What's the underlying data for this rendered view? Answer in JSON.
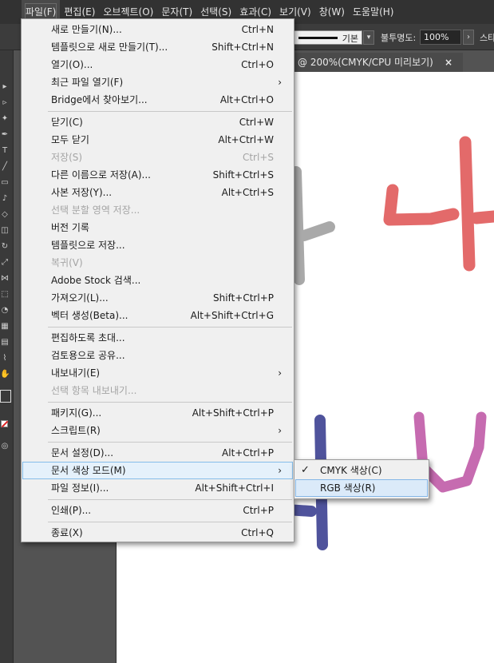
{
  "menubar": {
    "items": [
      {
        "label": "파일(F)"
      },
      {
        "label": "편집(E)"
      },
      {
        "label": "오브젝트(O)"
      },
      {
        "label": "문자(T)"
      },
      {
        "label": "선택(S)"
      },
      {
        "label": "효과(C)"
      },
      {
        "label": "보기(V)"
      },
      {
        "label": "창(W)"
      },
      {
        "label": "도움말(H)"
      }
    ]
  },
  "controlbar": {
    "stroke_label": "기본",
    "opacity_label": "불투명도:",
    "opacity_value": "100%",
    "style_label": "스타"
  },
  "document": {
    "tab_title": "@ 200%(CMYK/CPU 미리보기)",
    "close_glyph": "×"
  },
  "file_menu": {
    "new": {
      "label": "새로 만들기(N)...",
      "shortcut": "Ctrl+N"
    },
    "new_template": {
      "label": "템플릿으로 새로 만들기(T)...",
      "shortcut": "Shift+Ctrl+N"
    },
    "open": {
      "label": "열기(O)...",
      "shortcut": "Ctrl+O"
    },
    "recent": {
      "label": "최근 파일 열기(F)",
      "arrow": "›"
    },
    "bridge": {
      "label": "Bridge에서 찾아보기...",
      "shortcut": "Alt+Ctrl+O"
    },
    "close": {
      "label": "닫기(C)",
      "shortcut": "Ctrl+W"
    },
    "close_all": {
      "label": "모두 닫기",
      "shortcut": "Alt+Ctrl+W"
    },
    "save": {
      "label": "저장(S)",
      "shortcut": "Ctrl+S"
    },
    "save_as": {
      "label": "다른 이름으로 저장(A)...",
      "shortcut": "Shift+Ctrl+S"
    },
    "save_copy": {
      "label": "사본 저장(Y)...",
      "shortcut": "Alt+Ctrl+S"
    },
    "save_selected_slices": {
      "label": "선택 분할 영역 저장..."
    },
    "version_history": {
      "label": "버전 기록"
    },
    "save_template": {
      "label": "템플릿으로 저장..."
    },
    "revert": {
      "label": "복귀(V)"
    },
    "adobe_stock": {
      "label": "Adobe Stock 검색..."
    },
    "place": {
      "label": "가져오기(L)...",
      "shortcut": "Shift+Ctrl+P"
    },
    "generate_vectors": {
      "label": "벡터 생성(Beta)...",
      "shortcut": "Alt+Shift+Ctrl+G"
    },
    "invite": {
      "label": "편집하도록 초대..."
    },
    "share_review": {
      "label": "검토용으로 공유..."
    },
    "export": {
      "label": "내보내기(E)",
      "arrow": "›"
    },
    "export_selection": {
      "label": "선택 항목 내보내기..."
    },
    "package": {
      "label": "패키지(G)...",
      "shortcut": "Alt+Shift+Ctrl+P"
    },
    "scripts": {
      "label": "스크립트(R)",
      "arrow": "›"
    },
    "document_setup": {
      "label": "문서 설정(D)...",
      "shortcut": "Alt+Ctrl+P"
    },
    "color_mode": {
      "label": "문서 색상 모드(M)",
      "arrow": "›"
    },
    "file_info": {
      "label": "파일 정보(I)...",
      "shortcut": "Alt+Shift+Ctrl+I"
    },
    "print": {
      "label": "인쇄(P)...",
      "shortcut": "Ctrl+P"
    },
    "exit": {
      "label": "종료(X)",
      "shortcut": "Ctrl+Q"
    }
  },
  "color_mode_submenu": {
    "cmyk": {
      "label": "CMYK 색상(C)",
      "check": "✓",
      "checked": true
    },
    "rgb": {
      "label": "RGB 색상(R)",
      "checked": false
    }
  },
  "artwork_colors": {
    "gray": "#a9a9a9",
    "red": "#e36a6a",
    "blue": "#4f539c",
    "purple": "#c66bb0"
  },
  "toolbar": {
    "icons": [
      "selection-tool-icon",
      "direct-select-tool-icon",
      "magic-wand-icon",
      "pen-tool-icon",
      "type-tool-icon",
      "line-tool-icon",
      "rectangle-tool-icon",
      "brush-tool-icon",
      "shaper-tool-icon",
      "eraser-tool-icon",
      "rotate-tool-icon",
      "scale-tool-icon",
      "width-tool-icon",
      "free-transform-icon",
      "shape-builder-icon",
      "perspective-grid-icon",
      "mesh-tool-icon",
      "gradient-tool-icon",
      "eyedropper-tool-icon",
      "blend-tool-icon",
      "symbol-sprayer-icon",
      "graph-tool-icon",
      "artboard-tool-icon",
      "slice-tool-icon",
      "hand-tool-icon",
      "zoom-tool-icon"
    ]
  }
}
